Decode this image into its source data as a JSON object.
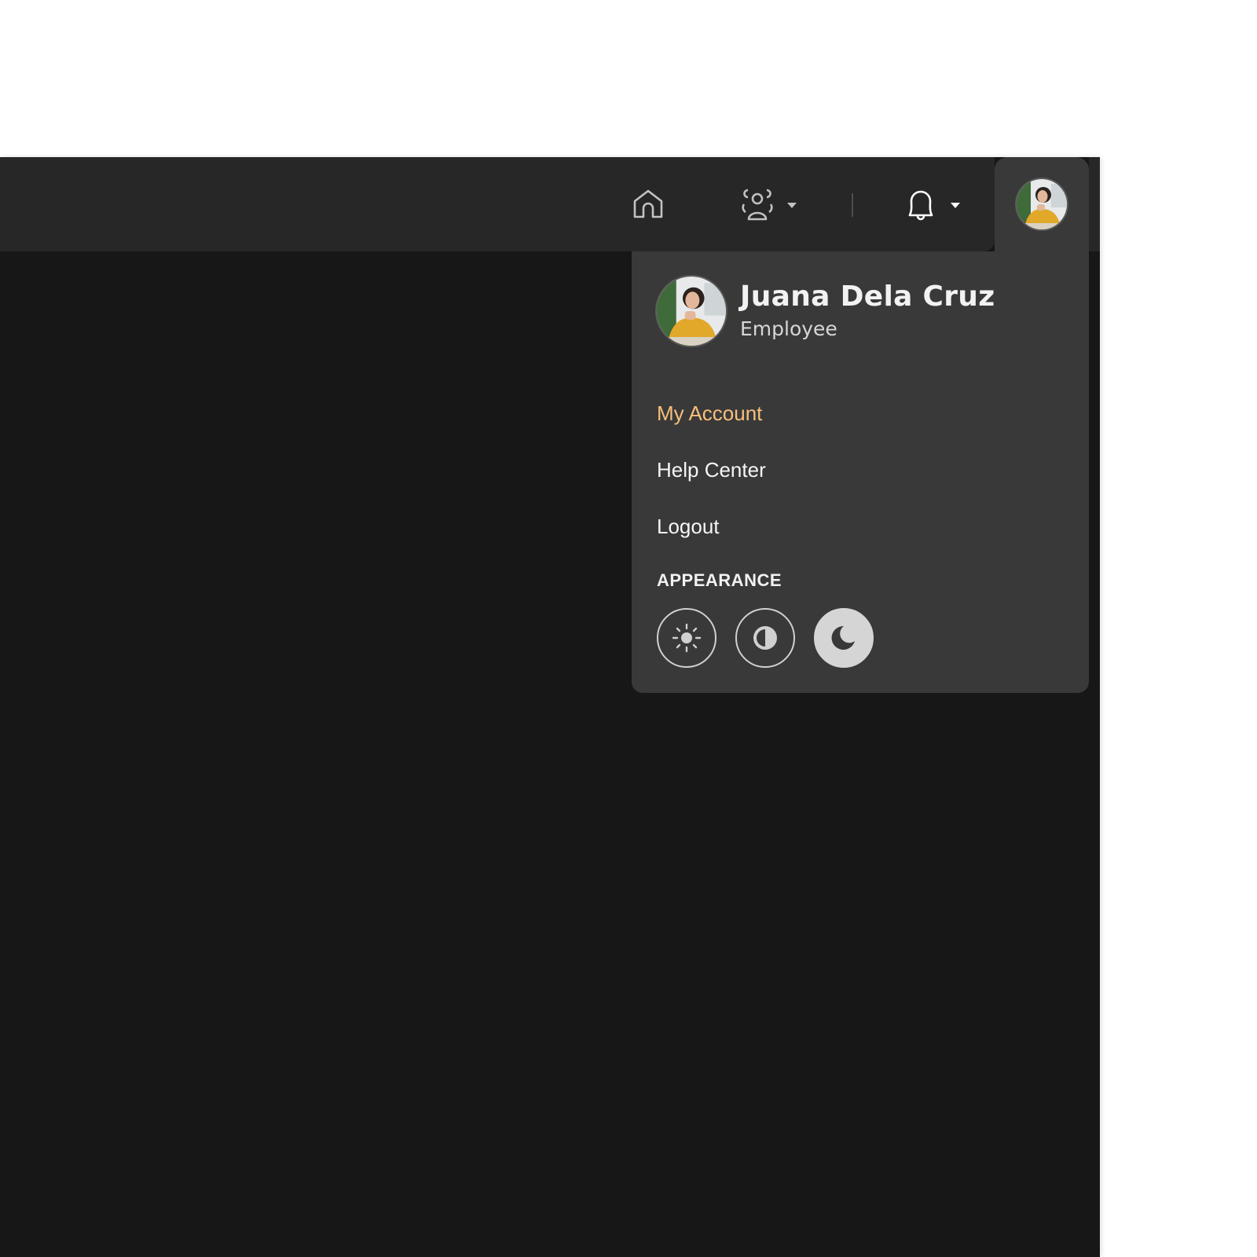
{
  "header": {
    "nav": [
      {
        "icon": "home-icon",
        "label": "Home"
      },
      {
        "icon": "team-icon",
        "label": "Team",
        "has_dropdown": true
      },
      {
        "icon": "bell-icon",
        "label": "Notifications",
        "has_dropdown": true
      }
    ],
    "avatar_alt": "Juana Dela Cruz"
  },
  "profile_menu": {
    "user": {
      "name": "Juana Dela Cruz",
      "role": "Employee"
    },
    "items": [
      {
        "label": "My Account",
        "active": true
      },
      {
        "label": "Help Center",
        "active": false
      },
      {
        "label": "Logout",
        "active": false
      }
    ],
    "appearance": {
      "label": "APPEARANCE",
      "options": [
        {
          "name": "light",
          "icon": "sun-icon",
          "selected": false
        },
        {
          "name": "system",
          "icon": "contrast-icon",
          "selected": false
        },
        {
          "name": "dark",
          "icon": "moon-icon",
          "selected": true
        }
      ]
    }
  },
  "colors": {
    "accent": "#f8bf7d",
    "panel_bg": "#171717",
    "header_bg": "#272727",
    "menu_bg": "#393939"
  }
}
